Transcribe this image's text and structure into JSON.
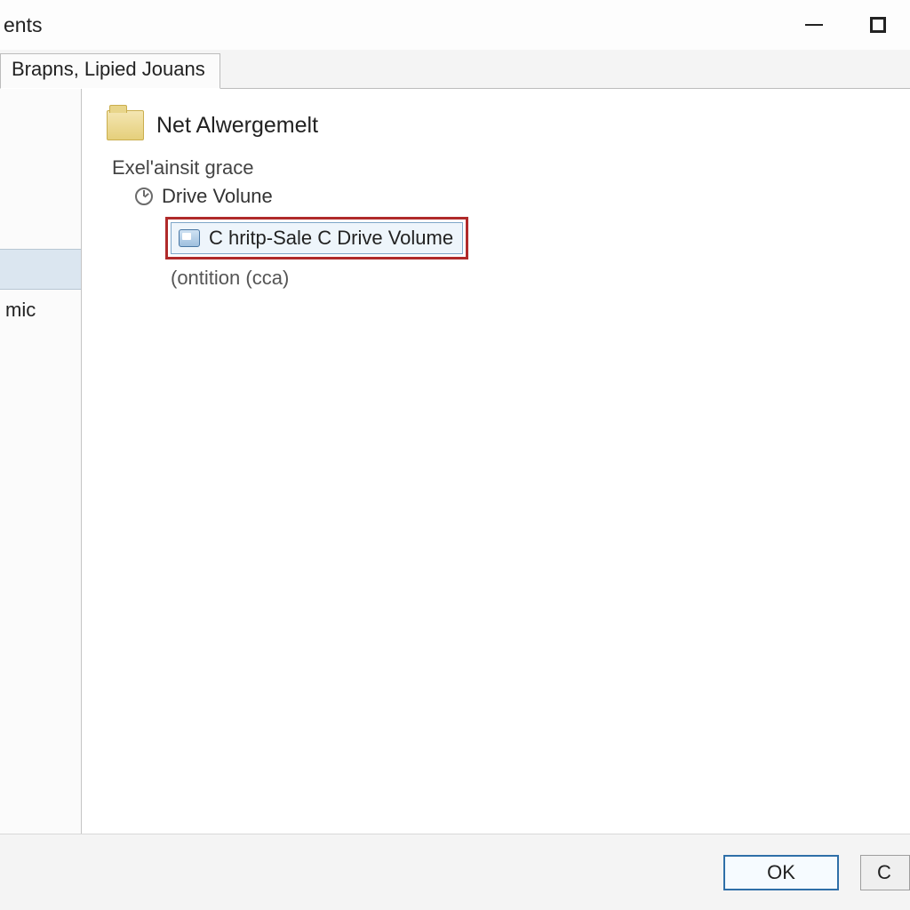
{
  "window": {
    "title_fragment": "ents"
  },
  "tabs": {
    "active": "Brapns, Lipied Jouans"
  },
  "sidebar": {
    "item_selected": "",
    "item2": "mic"
  },
  "header": {
    "title": "Net Alwergemelt"
  },
  "tree": {
    "level1": "Exel'ainsit grace",
    "level2": "Drive Volune",
    "level3": "C hritp-Sale C Drive Volume",
    "level3_sub": "(ontition (cca)"
  },
  "footer": {
    "ok": "OK",
    "cancel_fragment": "C"
  }
}
